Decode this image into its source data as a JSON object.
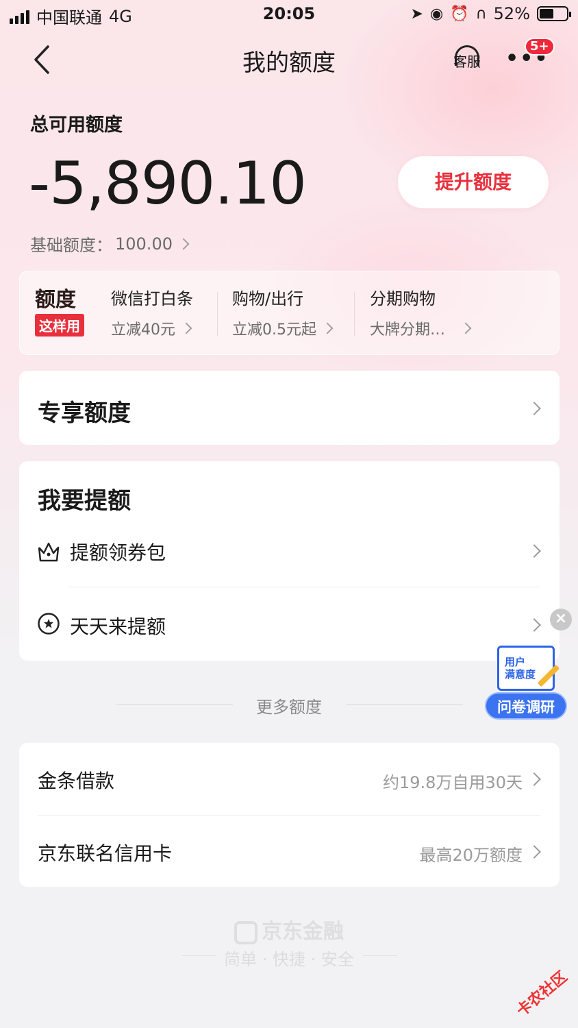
{
  "status_bar": {
    "carrier": "中国联通",
    "network": "4G",
    "time": "20:05",
    "battery": "52%",
    "icons": [
      "location-icon",
      "rotation-lock-icon",
      "alarm-icon",
      "headphones-icon"
    ]
  },
  "nav": {
    "title": "我的额度",
    "service_label": "客服",
    "more_badge": "5+"
  },
  "quota": {
    "label": "总可用额度",
    "amount": "-5,890.10",
    "raise_button": "提升额度",
    "base_label": "基础额度：",
    "base_value": "100.00"
  },
  "usage": {
    "tag_big": "额度",
    "tag_small": "这样用",
    "items": [
      {
        "title": "微信打白条",
        "sub": "立减40元"
      },
      {
        "title": "购物/出行",
        "sub": "立减0.5元起"
      },
      {
        "title": "分期购物",
        "sub": "大牌分期…"
      }
    ]
  },
  "exclusive": {
    "title": "专享额度"
  },
  "raise_section": {
    "title": "我要提额",
    "rows": [
      {
        "label": "提额领券包",
        "icon": "crown-icon"
      },
      {
        "label": "天天来提额",
        "icon": "star-badge-icon"
      }
    ]
  },
  "more": {
    "title": "更多额度",
    "rows": [
      {
        "label": "金条借款",
        "sub": "约19.8万自用30天"
      },
      {
        "label": "京东联名信用卡",
        "sub": "最高20万额度"
      }
    ]
  },
  "survey": {
    "paper_text_1": "用户",
    "paper_text_2": "满意度",
    "pill": "问卷调研"
  },
  "footer": {
    "brand": "京东金融",
    "slogan": "简单 · 快捷 · 安全"
  },
  "watermark": "卡农社区",
  "colors": {
    "accent_red": "#e8303c",
    "badge_red": "#f0283c",
    "survey_blue": "#3b73f0"
  }
}
